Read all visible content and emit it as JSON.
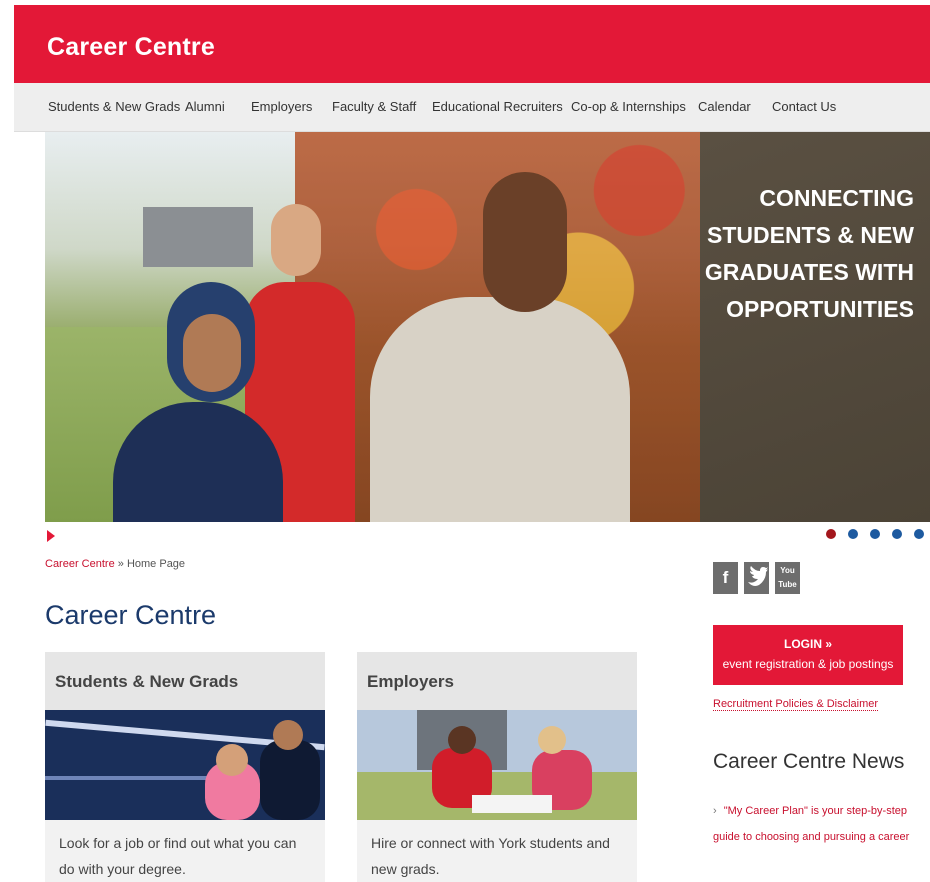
{
  "header": {
    "site_title": "Career Centre"
  },
  "nav": {
    "items": [
      "Students & New Grads",
      "Alumni",
      "Employers",
      "Faculty & Staff",
      "Educational Recruiters",
      "Co-op & Internships",
      "Calendar",
      "Contact Us"
    ]
  },
  "hero": {
    "headline": "CONNECTING STUDENTS & NEW GRADUATES WITH OPPORTUNITIES",
    "slides_count": 5,
    "active_slide": 1
  },
  "breadcrumb": {
    "home": "Career Centre",
    "separator": "»",
    "current": "Home Page"
  },
  "main": {
    "title": "Career Centre",
    "cards": [
      {
        "title": "Students & New Grads",
        "text": "Look for a job or find out what you can do with your degree."
      },
      {
        "title": "Employers",
        "text": "Hire or connect with York students and new grads."
      }
    ]
  },
  "sidebar": {
    "social": [
      "facebook-icon",
      "twitter-icon",
      "youtube-icon"
    ],
    "social_labels": [
      "f",
      "t",
      "You Tube"
    ],
    "login": {
      "line1": "LOGIN »",
      "line2": "event registration & job postings"
    },
    "policy_link": "Recruitment Policies & Disclaimer",
    "news_title": "Career Centre News",
    "news_items": [
      "\"My Career Plan\" is your step-by-step guide to choosing and pursuing a career"
    ]
  },
  "colors": {
    "brand_red": "#e31837",
    "title_blue": "#1b3a6b",
    "dot_blue": "#1d5aa0",
    "dot_active": "#a3161c"
  }
}
